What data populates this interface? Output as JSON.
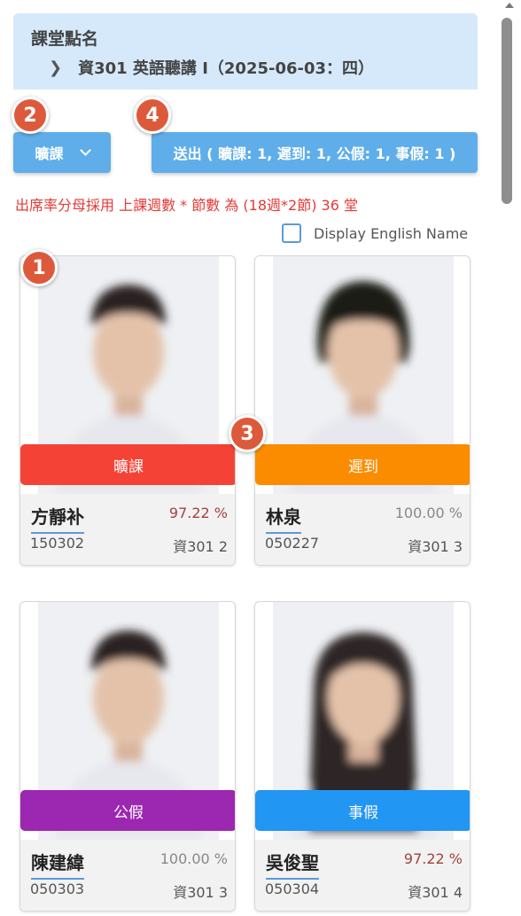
{
  "header": {
    "title": "課堂點名",
    "course": "資301 英語聽講 I（2025-06-03：四）"
  },
  "toolbar": {
    "status_select": "曠課",
    "submit_label": "送出 ( 曠課: 1, 遲到: 1, 公假: 1, 事假: 1 )"
  },
  "badges": [
    "1",
    "2",
    "3",
    "4"
  ],
  "note": "出席率分母採用 上課週數 * 節數 為 (18週*2節) 36 堂",
  "english_toggle_label": "Display English Name",
  "students": [
    {
      "status": "曠課",
      "status_color": "#f44336",
      "name": "方靜补",
      "percent": "97.22 %",
      "percent_color": "#a0443c",
      "id": "150302",
      "class_seat": "資301  2",
      "hair": "short"
    },
    {
      "status": "遲到",
      "status_color": "#fb8c00",
      "name": "林泉",
      "percent": "100.00 %",
      "percent_color": "#888888",
      "id": "050227",
      "class_seat": "資301  3",
      "hair": "bangs"
    },
    {
      "status": "公假",
      "status_color": "#9c27b0",
      "name": "陳建緯",
      "percent": "100.00 %",
      "percent_color": "#888888",
      "id": "050303",
      "class_seat": "資301  3",
      "hair": "short"
    },
    {
      "status": "事假",
      "status_color": "#2196f3",
      "name": "吳俊聖",
      "percent": "97.22 %",
      "percent_color": "#a0443c",
      "id": "050304",
      "class_seat": "資301  4",
      "hair": "long"
    }
  ]
}
